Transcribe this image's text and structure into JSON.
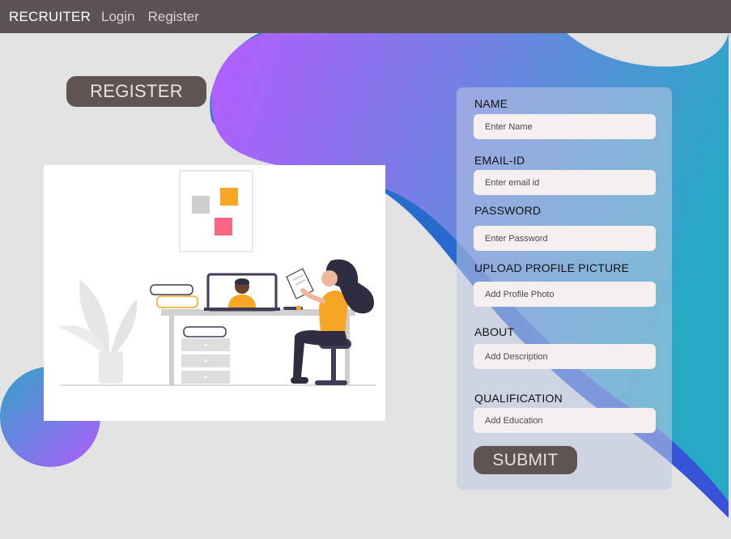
{
  "nav": {
    "brand": "RECRUITER",
    "links": [
      "Login",
      "Register"
    ]
  },
  "hero": {
    "register_title": "REGISTER"
  },
  "form": {
    "fields": [
      {
        "label": "NAME",
        "placeholder": "Enter Name"
      },
      {
        "label": "EMAIL-ID",
        "placeholder": "Enter email id"
      },
      {
        "label": "PASSWORD",
        "placeholder": "Enter Password"
      },
      {
        "label": "UPLOAD PROFILE PICTURE",
        "placeholder": "Add Profile Photo"
      },
      {
        "label": "ABOUT",
        "placeholder": "Add Description"
      },
      {
        "label": "QUALIFICATION",
        "placeholder": "Add Education"
      }
    ],
    "submit_label": "SUBMIT"
  },
  "colors": {
    "navbar": "#5b5452",
    "button": "#5e5553",
    "blob_start": "#b15cff",
    "blob_end": "#2aa6c8"
  }
}
